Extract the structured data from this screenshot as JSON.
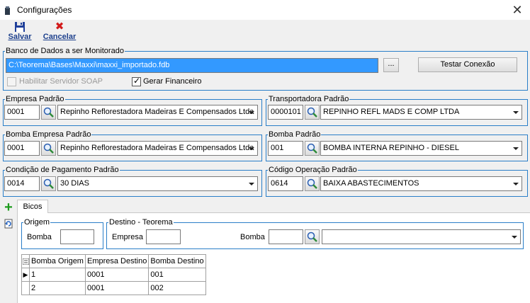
{
  "window": {
    "title": "Configurações"
  },
  "toolbar": {
    "save_label": "Salvar",
    "cancel_label": "Cancelar"
  },
  "database": {
    "group_title": "Banco de Dados a ser Monitorado",
    "path": "C:\\Teorema\\Bases\\Maxxi\\maxxi_importado.fdb",
    "browse_label": "...",
    "test_label": "Testar Conexão",
    "soap_label": "Habilitar Servidor SOAP",
    "soap_checked": false,
    "financeiro_label": "Gerar Financeiro",
    "financeiro_checked": true
  },
  "empresa_padrao": {
    "title": "Empresa Padrão",
    "code": "0001",
    "name": "Repinho Reflorestadora Madeiras E Compensados Ltda"
  },
  "transportadora_padrao": {
    "title": "Transportadora Padrão",
    "code": "0000101",
    "name": "REPINHO REFL MADS E COMP LTDA"
  },
  "bomba_empresa_padrao": {
    "title": "Bomba Empresa Padrão",
    "code": "0001",
    "name": "Repinho Reflorestadora Madeiras E Compensados Ltda"
  },
  "bomba_padrao": {
    "title": "Bomba Padrão",
    "code": "001",
    "name": "BOMBA INTERNA REPINHO - DIESEL"
  },
  "condicao_pagamento": {
    "title": "Condição de Pagamento Padrão",
    "code": "0014",
    "name": "30 DIAS"
  },
  "codigo_operacao": {
    "title": "Código Operação Padrão",
    "code": "0614",
    "name": "BAIXA ABASTECIMENTOS"
  },
  "tabs": {
    "bicos": "Bicos"
  },
  "origem": {
    "title": "Origem",
    "bomba_label": "Bomba",
    "bomba_value": ""
  },
  "destino": {
    "title": "Destino - Teorema",
    "empresa_label": "Empresa",
    "empresa_value": "",
    "bomba_label": "Bomba",
    "bomba_value": "",
    "bomba_name": ""
  },
  "grid": {
    "columns": [
      "Bomba Origem",
      "Empresa Destino",
      "Bomba Destino"
    ],
    "rows": [
      [
        "1",
        "0001",
        "001"
      ],
      [
        "2",
        "0001",
        "002"
      ]
    ]
  },
  "icons": {
    "add": "plus-icon",
    "refresh": "refresh-icon",
    "lookup": "magnifier-icon",
    "save": "floppy-icon",
    "cancel": "x-icon"
  }
}
